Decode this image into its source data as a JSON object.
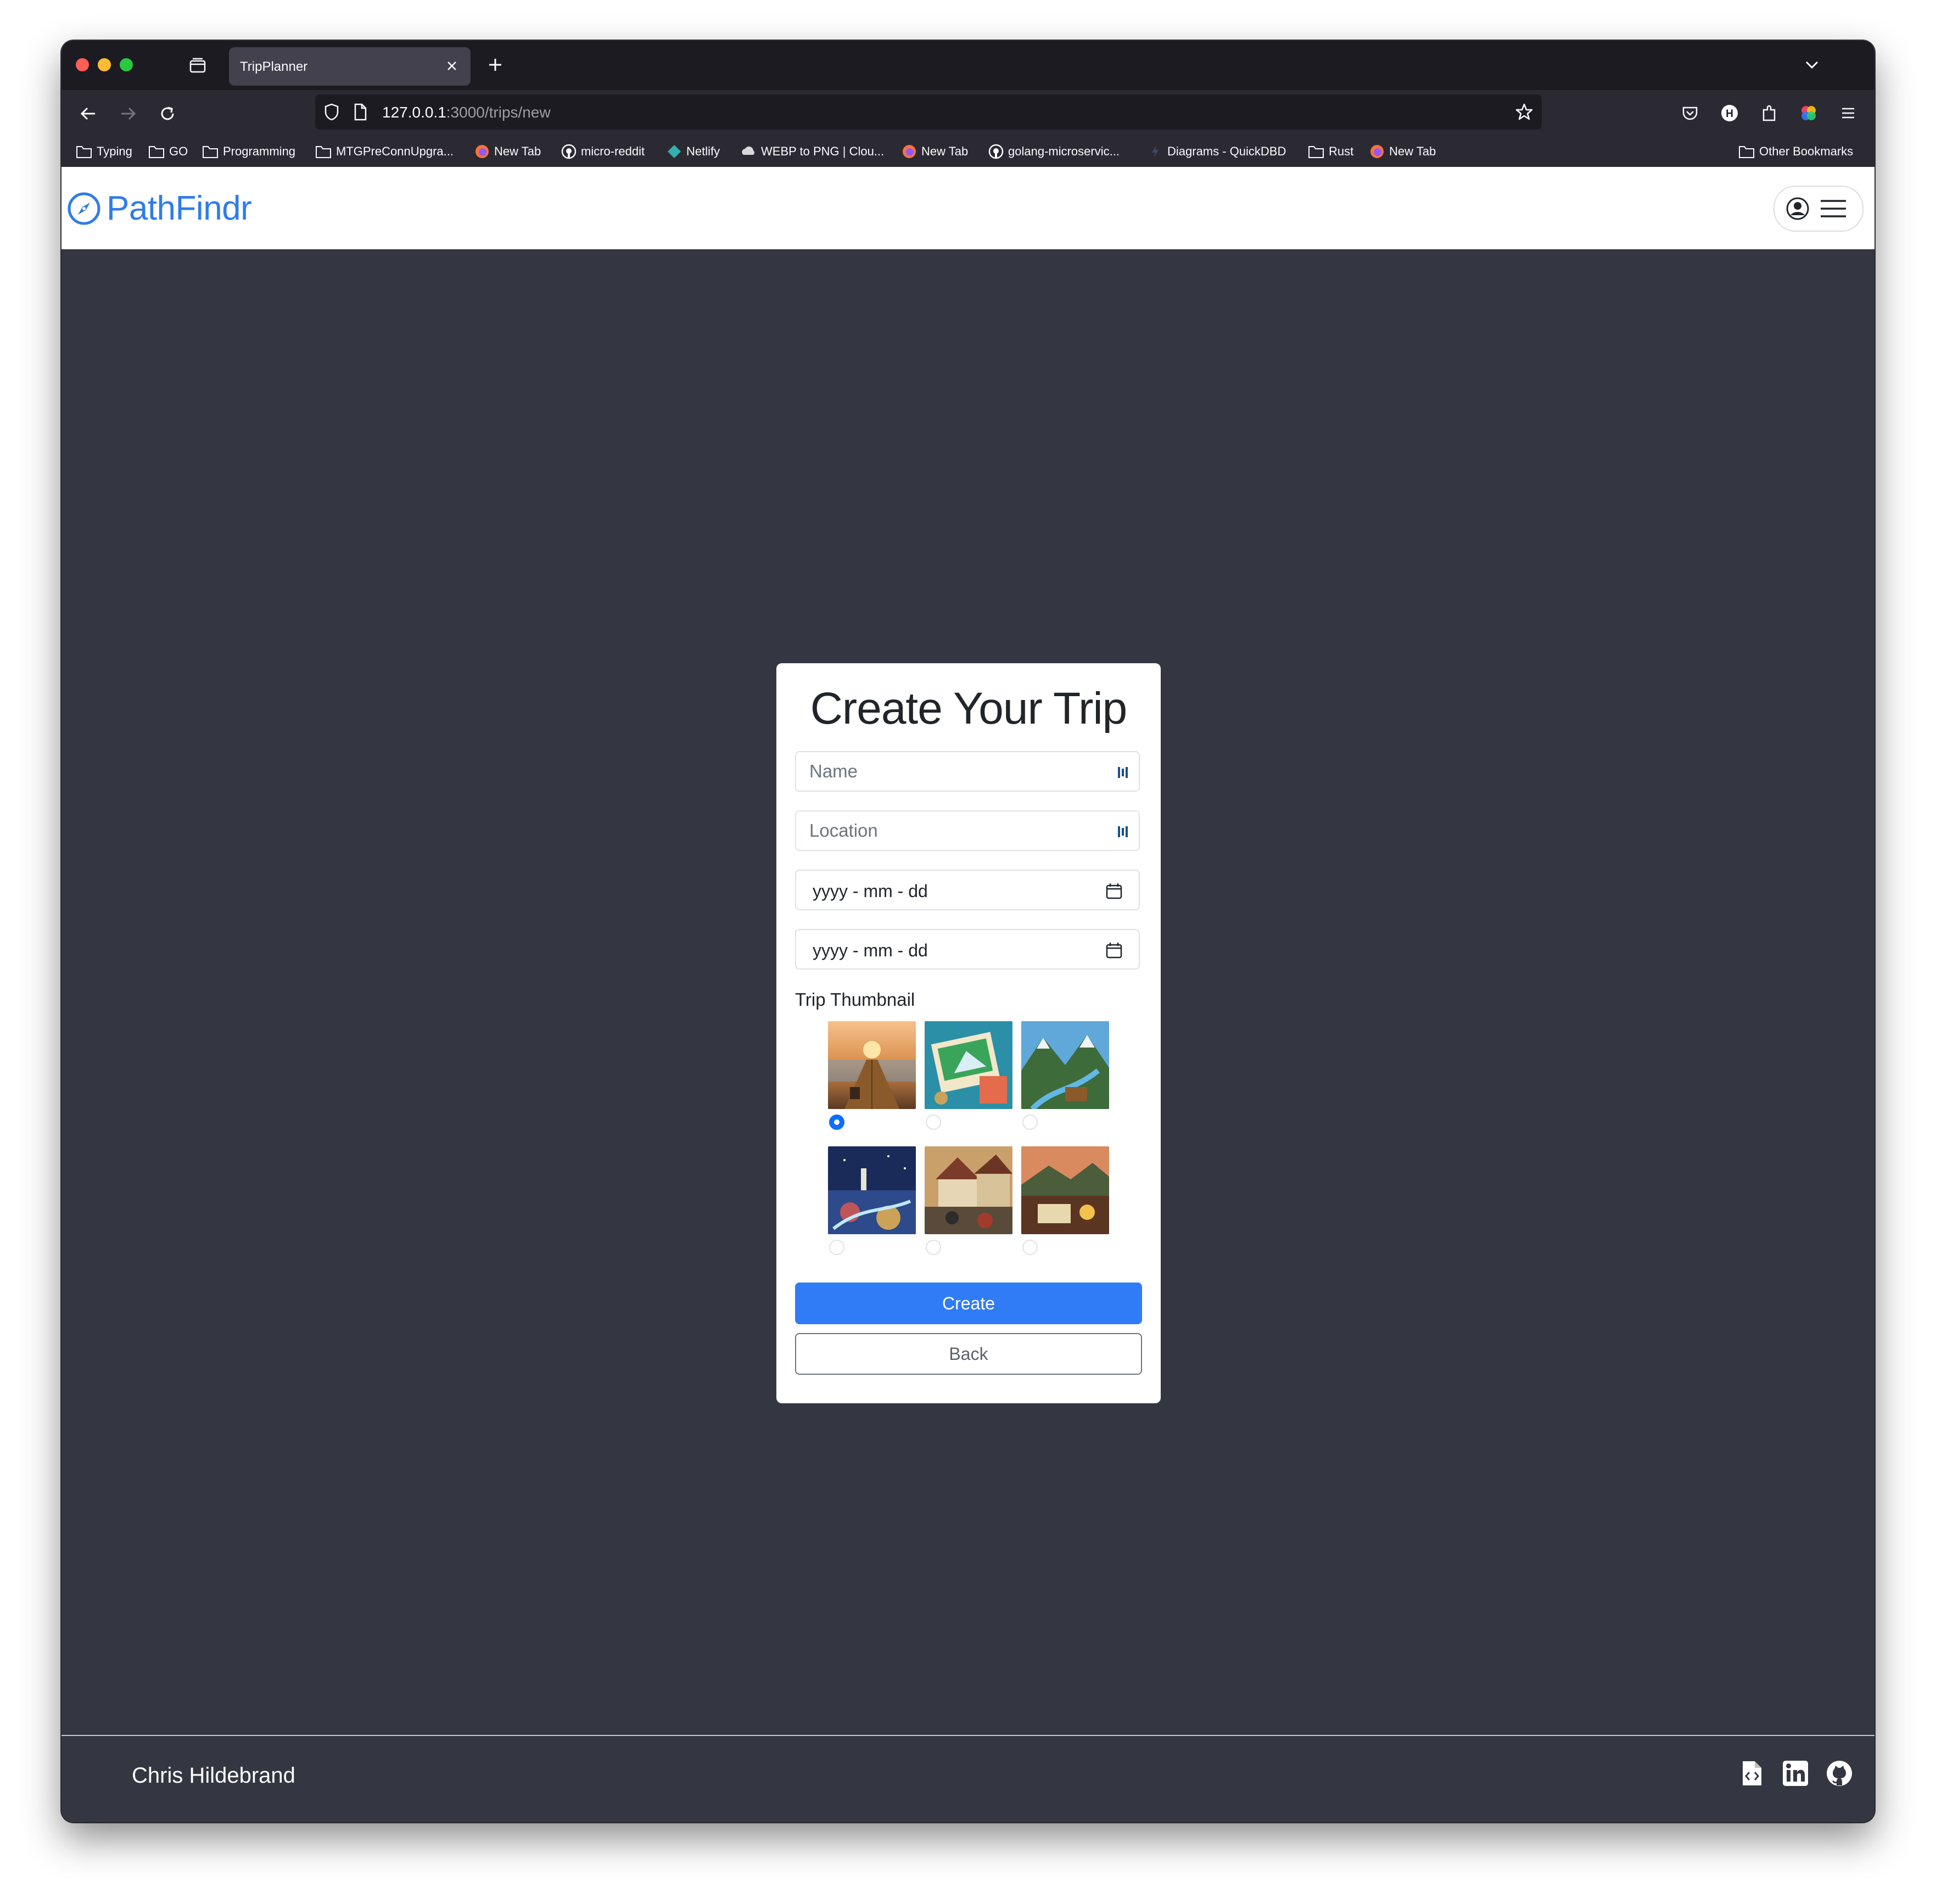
{
  "browser": {
    "tab_title": "TripPlanner",
    "url_host": "127.0.0.1",
    "url_rest": ":3000/trips/new",
    "bookmarks": [
      {
        "label": "Typing",
        "icon": "folder-icon"
      },
      {
        "label": "GO",
        "icon": "folder-icon"
      },
      {
        "label": "Programming",
        "icon": "folder-icon"
      },
      {
        "label": "MTGPreConnUpgra...",
        "icon": "folder-icon"
      },
      {
        "label": "New Tab",
        "icon": "firefox-icon"
      },
      {
        "label": "micro-reddit",
        "icon": "github-icon"
      },
      {
        "label": "Netlify",
        "icon": "netlify-icon"
      },
      {
        "label": "WEBP to PNG | Clou...",
        "icon": "cloud-icon"
      },
      {
        "label": "New Tab",
        "icon": "firefox-icon"
      },
      {
        "label": "golang-microservic...",
        "icon": "github-icon"
      },
      {
        "label": "Diagrams - QuickDBD",
        "icon": "quickdbd-icon"
      },
      {
        "label": "Rust",
        "icon": "folder-icon"
      },
      {
        "label": "New Tab",
        "icon": "firefox-icon"
      }
    ],
    "other_bookmarks": "Other Bookmarks"
  },
  "header": {
    "brand": "PathFindr",
    "brand_color": "#2f7ce8"
  },
  "form": {
    "title": "Create Your Trip",
    "name_placeholder": "Name",
    "location_placeholder": "Location",
    "start_date_placeholder": "yyyy - mm - dd",
    "end_date_placeholder": "yyyy - mm - dd",
    "thumbnail_label": "Trip Thumbnail",
    "thumbnails": [
      {
        "name": "pier-sunset",
        "selected": true
      },
      {
        "name": "map-postcards",
        "selected": false
      },
      {
        "name": "mountain-valley",
        "selected": false
      },
      {
        "name": "night-city-lights",
        "selected": false
      },
      {
        "name": "old-town-market",
        "selected": false
      },
      {
        "name": "cozy-travel-desk",
        "selected": false
      }
    ],
    "create_label": "Create",
    "back_label": "Back",
    "primary_color": "#2f7cf6"
  },
  "footer": {
    "name": "Chris Hildebrand",
    "links": [
      "resume-icon",
      "linkedin-icon",
      "github-icon"
    ]
  }
}
